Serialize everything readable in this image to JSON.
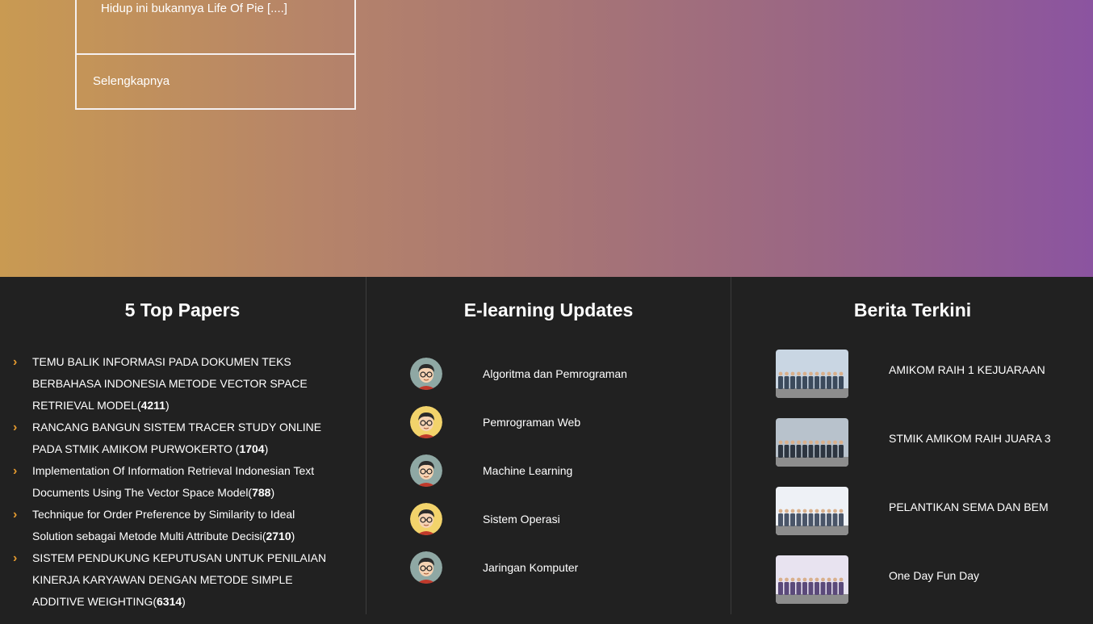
{
  "hero": {
    "excerpt": "Hidup ini bukannya Life Of Pie [....]",
    "more_label": "Selengkapnya"
  },
  "top_papers": {
    "title": "5 Top Papers",
    "items": [
      {
        "text": "TEMU BALIK INFORMASI PADA DOKUMEN TEKS BERBAHASA INDONESIA METODE VECTOR SPACE RETRIEVAL MODEL(",
        "count": "4211",
        "close": ")"
      },
      {
        "text": "RANCANG BANGUN SISTEM TRACER STUDY ONLINE PADA STMIK AMIKOM PURWOKERTO (",
        "count": "1704",
        "close": ")"
      },
      {
        "text": "Implementation Of Information Retrieval Indonesian Text Documents Using The Vector Space Model(",
        "count": "788",
        "close": ")"
      },
      {
        "text": "Technique for Order Preference by Similarity to Ideal Solution sebagai Metode Multi Attribute Decisi(",
        "count": "2710",
        "close": ")"
      },
      {
        "text": "SISTEM PENDUKUNG KEPUTUSAN UNTUK PENILAIAN KINERJA KARYAWAN DENGAN METODE SIMPLE ADDITIVE WEIGHTING(",
        "count": "6314",
        "close": ")"
      }
    ]
  },
  "elearning": {
    "title": "E-learning Updates",
    "items": [
      {
        "label": "Algoritma dan Pemrograman",
        "avatar_bg": "#8fa8a4"
      },
      {
        "label": "Pemrograman Web",
        "avatar_bg": "#f2d36b"
      },
      {
        "label": "Machine Learning",
        "avatar_bg": "#8fa8a4"
      },
      {
        "label": "Sistem Operasi",
        "avatar_bg": "#f2d36b"
      },
      {
        "label": "Jaringan Komputer",
        "avatar_bg": "#8fa8a4"
      }
    ]
  },
  "news": {
    "title": "Berita Terkini",
    "items": [
      {
        "label": "AMIKOM RAIH 1 KEJUARAAN"
      },
      {
        "label": "STMIK AMIKOM RAIH JUARA 3"
      },
      {
        "label": "PELANTIKAN SEMA DAN BEM"
      },
      {
        "label": "One Day Fun Day"
      }
    ]
  },
  "colors": {
    "accent": "#e49a2f",
    "footer_bg": "#212121",
    "gradient_start": "#c99a52",
    "gradient_end": "#8b54a0"
  }
}
